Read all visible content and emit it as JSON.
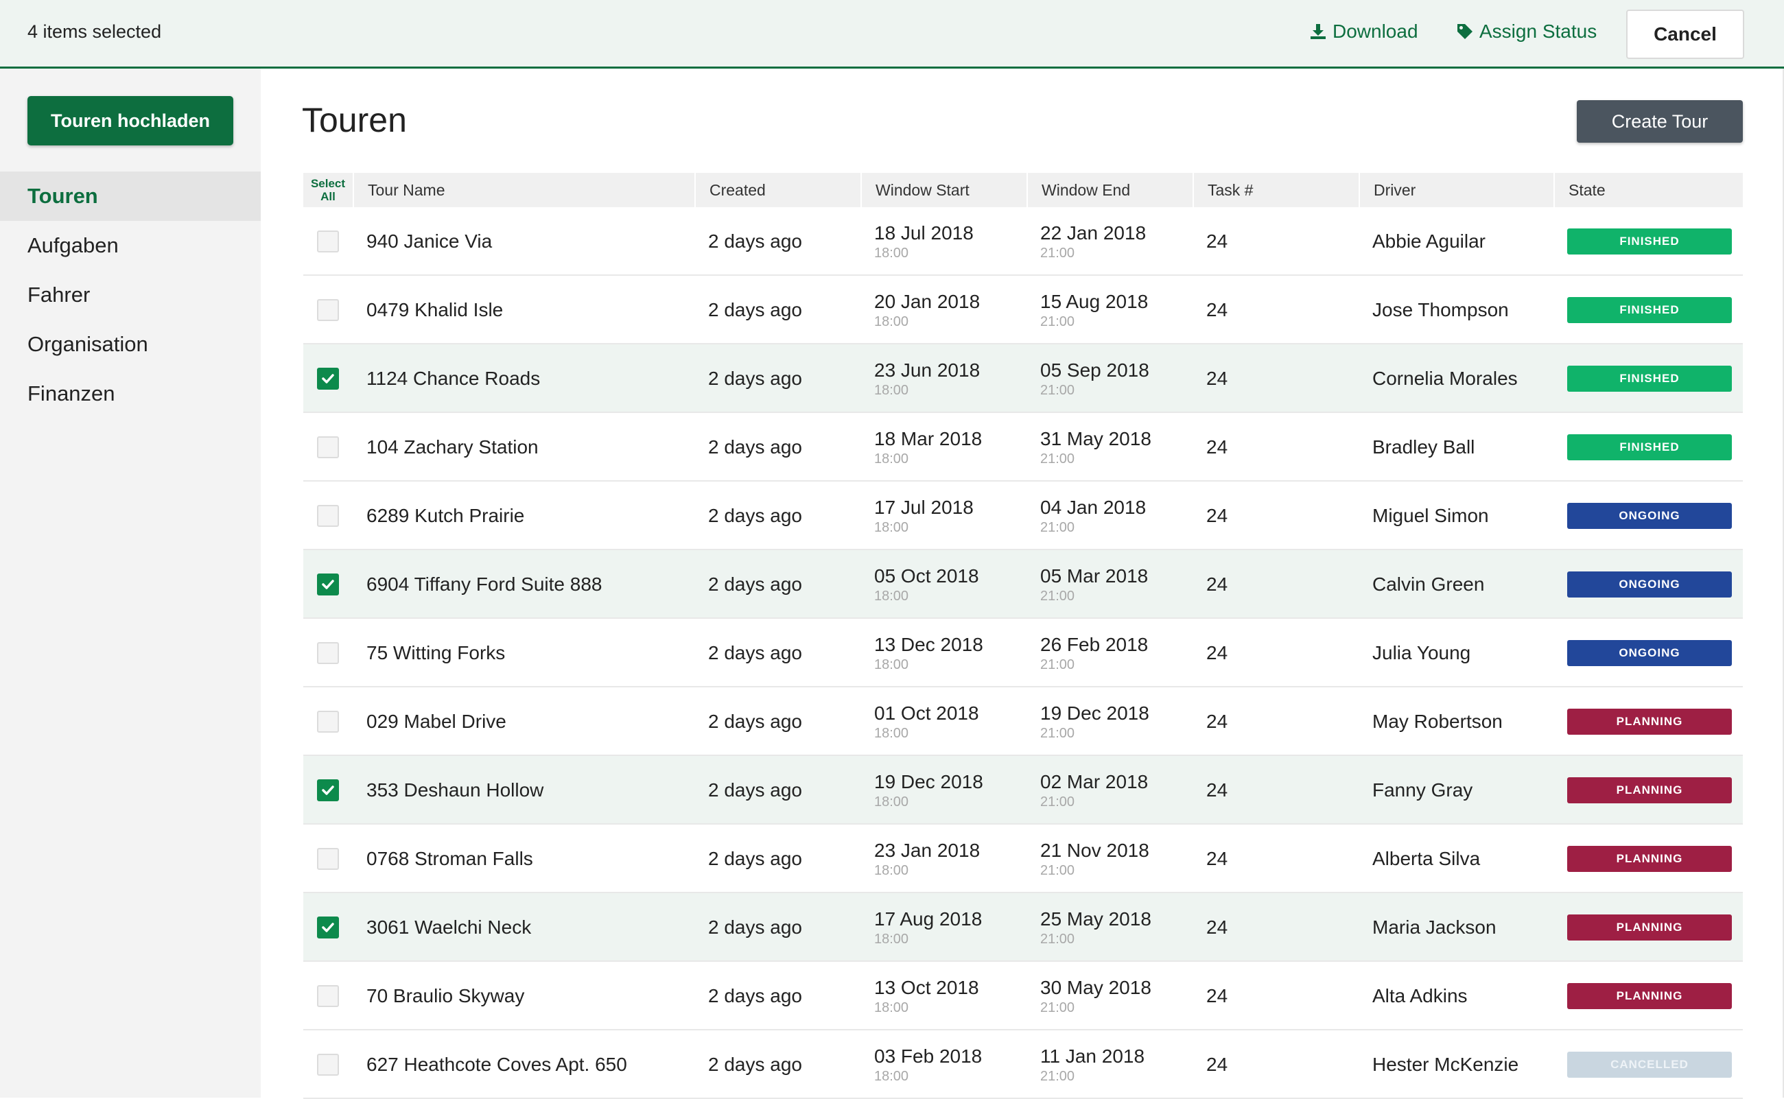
{
  "selection_bar": {
    "count_label": "4 items selected",
    "download_label": "Download",
    "assign_status_label": "Assign Status",
    "cancel_label": "Cancel"
  },
  "sidebar": {
    "upload_label": "Touren hochladen",
    "items": [
      {
        "label": "Touren",
        "active": true
      },
      {
        "label": "Aufgaben",
        "active": false
      },
      {
        "label": "Fahrer",
        "active": false
      },
      {
        "label": "Organisation",
        "active": false
      },
      {
        "label": "Finanzen",
        "active": false
      }
    ]
  },
  "main": {
    "title": "Touren",
    "create_label": "Create Tour"
  },
  "table": {
    "select_all_label": "Select All",
    "columns": [
      "Tour Name",
      "Created",
      "Window Start",
      "Window End",
      "Task #",
      "Driver",
      "State"
    ],
    "rows": [
      {
        "selected": false,
        "name": "940 Janice Via",
        "created": "2 days ago",
        "start_date": "18 Jul 2018",
        "start_time": "18:00",
        "end_date": "22 Jan 2018",
        "end_time": "21:00",
        "tasks": "24",
        "driver": "Abbie Aguilar",
        "state": "FINISHED"
      },
      {
        "selected": false,
        "name": "0479 Khalid Isle",
        "created": "2 days ago",
        "start_date": "20 Jan 2018",
        "start_time": "18:00",
        "end_date": "15 Aug 2018",
        "end_time": "21:00",
        "tasks": "24",
        "driver": "Jose Thompson",
        "state": "FINISHED"
      },
      {
        "selected": true,
        "name": "1124 Chance Roads",
        "created": "2 days ago",
        "start_date": "23 Jun 2018",
        "start_time": "18:00",
        "end_date": "05 Sep 2018",
        "end_time": "21:00",
        "tasks": "24",
        "driver": "Cornelia Morales",
        "state": "FINISHED"
      },
      {
        "selected": false,
        "name": "104 Zachary Station",
        "created": "2 days ago",
        "start_date": "18 Mar 2018",
        "start_time": "18:00",
        "end_date": "31 May 2018",
        "end_time": "21:00",
        "tasks": "24",
        "driver": "Bradley Ball",
        "state": "FINISHED"
      },
      {
        "selected": false,
        "name": "6289 Kutch Prairie",
        "created": "2 days ago",
        "start_date": "17 Jul 2018",
        "start_time": "18:00",
        "end_date": "04 Jan 2018",
        "end_time": "21:00",
        "tasks": "24",
        "driver": "Miguel Simon",
        "state": "ONGOING"
      },
      {
        "selected": true,
        "name": "6904 Tiffany Ford Suite 888",
        "created": "2 days ago",
        "start_date": "05 Oct 2018",
        "start_time": "18:00",
        "end_date": "05 Mar 2018",
        "end_time": "21:00",
        "tasks": "24",
        "driver": "Calvin Green",
        "state": "ONGOING"
      },
      {
        "selected": false,
        "name": "75 Witting Forks",
        "created": "2 days ago",
        "start_date": "13 Dec 2018",
        "start_time": "18:00",
        "end_date": "26 Feb 2018",
        "end_time": "21:00",
        "tasks": "24",
        "driver": "Julia Young",
        "state": "ONGOING"
      },
      {
        "selected": false,
        "name": "029 Mabel Drive",
        "created": "2 days ago",
        "start_date": "01 Oct 2018",
        "start_time": "18:00",
        "end_date": "19 Dec 2018",
        "end_time": "21:00",
        "tasks": "24",
        "driver": "May Robertson",
        "state": "PLANNING"
      },
      {
        "selected": true,
        "name": "353 Deshaun Hollow",
        "created": "2 days ago",
        "start_date": "19 Dec 2018",
        "start_time": "18:00",
        "end_date": "02 Mar 2018",
        "end_time": "21:00",
        "tasks": "24",
        "driver": "Fanny Gray",
        "state": "PLANNING"
      },
      {
        "selected": false,
        "name": "0768 Stroman Falls",
        "created": "2 days ago",
        "start_date": "23 Jan 2018",
        "start_time": "18:00",
        "end_date": "21 Nov 2018",
        "end_time": "21:00",
        "tasks": "24",
        "driver": "Alberta Silva",
        "state": "PLANNING"
      },
      {
        "selected": true,
        "name": "3061 Waelchi Neck",
        "created": "2 days ago",
        "start_date": "17 Aug 2018",
        "start_time": "18:00",
        "end_date": "25 May 2018",
        "end_time": "21:00",
        "tasks": "24",
        "driver": "Maria Jackson",
        "state": "PLANNING"
      },
      {
        "selected": false,
        "name": "70 Braulio Skyway",
        "created": "2 days ago",
        "start_date": "13 Oct 2018",
        "start_time": "18:00",
        "end_date": "30 May 2018",
        "end_time": "21:00",
        "tasks": "24",
        "driver": "Alta Adkins",
        "state": "PLANNING"
      },
      {
        "selected": false,
        "name": "627 Heathcote Coves Apt. 650",
        "created": "2 days ago",
        "start_date": "03 Feb 2018",
        "start_time": "18:00",
        "end_date": "11 Jan 2018",
        "end_time": "21:00",
        "tasks": "24",
        "driver": "Hester McKenzie",
        "state": "CANCELLED"
      }
    ]
  },
  "state_colors": {
    "FINISHED": "#10b36a",
    "ONGOING": "#22479a",
    "PLANNING": "#9e1f44",
    "CANCELLED": "#c9d6e0"
  },
  "theme": {
    "brand_green": "#0d6e3f",
    "selected_row_bg": "#eef4f1"
  }
}
